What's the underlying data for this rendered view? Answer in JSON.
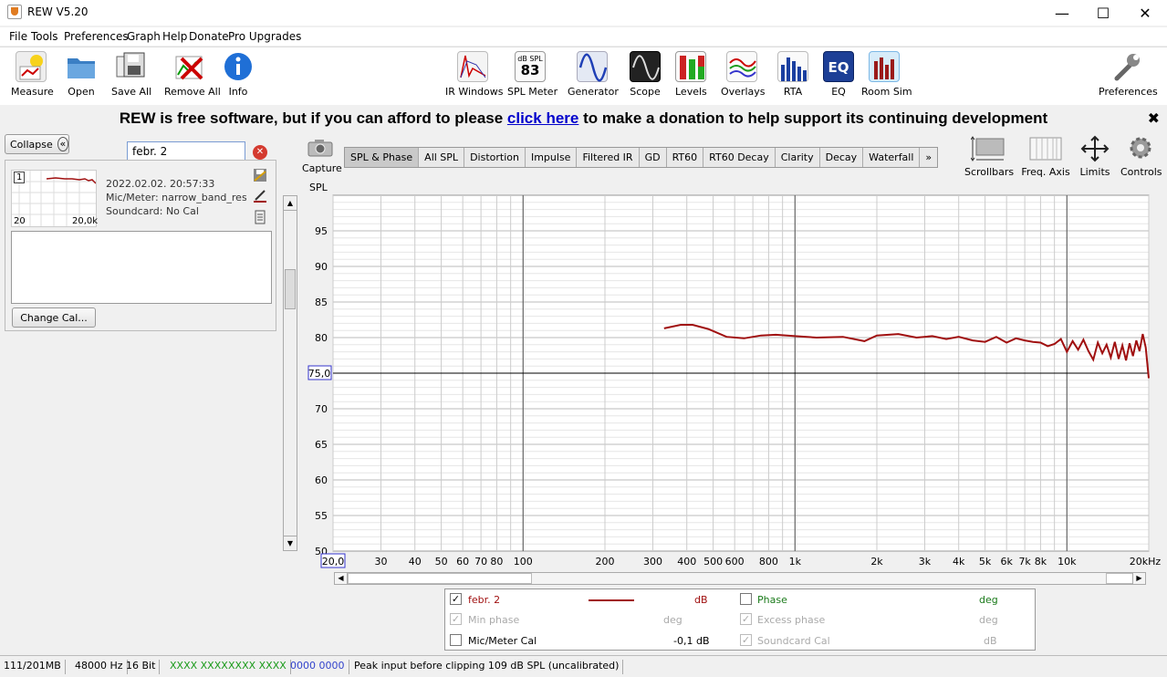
{
  "window": {
    "title": "REW V5.20",
    "minimize": "—",
    "maximize": "☐",
    "close": "✕"
  },
  "menu": [
    "File",
    "Tools",
    "Preferences",
    "Graph",
    "Help",
    "Donate",
    "Pro Upgrades"
  ],
  "toolbar_left": [
    "Measure",
    "Open",
    "Save All",
    "Remove All",
    "Info"
  ],
  "toolbar_center": [
    "IR Windows",
    "SPL Meter",
    "Generator",
    "Scope",
    "Levels",
    "Overlays",
    "RTA",
    "EQ",
    "Room Sim"
  ],
  "spl_meter_icon": {
    "unit": "dB SPL",
    "value": "83"
  },
  "eq_icon_text": "EQ",
  "toolbar_right": "Preferences",
  "banner": {
    "pre": "REW is free software, but if you can afford to please ",
    "link": "click here",
    "post": " to make a donation to help support its continuing development",
    "close": "✖"
  },
  "left": {
    "collapse": "Collapse",
    "collapse_icon": "«",
    "search_value": "febr. 2",
    "clear_icon": "✕",
    "measurement": {
      "index": "1",
      "thumb_min": "20",
      "thumb_max": "20,0k",
      "date": "2022.02.02. 20:57:33",
      "mic": "Mic/Meter: narrow_band_respo",
      "soundcard": "Soundcard: No Cal"
    },
    "change_cal": "Change Cal..."
  },
  "capture": "Capture",
  "tabs": [
    "SPL & Phase",
    "All SPL",
    "Distortion",
    "Impulse",
    "Filtered IR",
    "GD",
    "RT60",
    "RT60 Decay",
    "Clarity",
    "Decay",
    "Waterfall",
    "»"
  ],
  "right_tools": [
    "Scrollbars",
    "Freq. Axis",
    "Limits",
    "Controls"
  ],
  "scroll": {
    "up": "▲",
    "down": "▼",
    "left": "◀",
    "right": "▶"
  },
  "chart_data": {
    "type": "line",
    "ylabel": "SPL",
    "ylim": [
      50,
      100
    ],
    "yticks": [
      50,
      55,
      60,
      65,
      70,
      75,
      80,
      85,
      90,
      95
    ],
    "y_cursor_label": "75,0",
    "x_scale": "log",
    "xlim": [
      20,
      20000
    ],
    "xticks": [
      {
        "v": 20,
        "l": "20,0"
      },
      {
        "v": 30,
        "l": "30"
      },
      {
        "v": 40,
        "l": "40"
      },
      {
        "v": 50,
        "l": "50"
      },
      {
        "v": 60,
        "l": "60"
      },
      {
        "v": 70,
        "l": "70"
      },
      {
        "v": 80,
        "l": "80"
      },
      {
        "v": 100,
        "l": "100"
      },
      {
        "v": 200,
        "l": "200"
      },
      {
        "v": 300,
        "l": "300"
      },
      {
        "v": 400,
        "l": "400"
      },
      {
        "v": 500,
        "l": "500"
      },
      {
        "v": 600,
        "l": "600"
      },
      {
        "v": 800,
        "l": "800"
      },
      {
        "v": 1000,
        "l": "1k"
      },
      {
        "v": 2000,
        "l": "2k"
      },
      {
        "v": 3000,
        "l": "3k"
      },
      {
        "v": 4000,
        "l": "4k"
      },
      {
        "v": 5000,
        "l": "5k"
      },
      {
        "v": 6000,
        "l": "6k"
      },
      {
        "v": 7000,
        "l": "7k"
      },
      {
        "v": 8000,
        "l": "8k"
      },
      {
        "v": 10000,
        "l": "10k"
      },
      {
        "v": 20000,
        "l": "20kHz"
      }
    ],
    "grid": true,
    "reference_line": 75,
    "series": [
      {
        "name": "febr. 2",
        "color": "#a01010",
        "x": [
          330,
          380,
          420,
          480,
          560,
          650,
          750,
          850,
          1000,
          1200,
          1500,
          1800,
          2000,
          2400,
          2800,
          3200,
          3600,
          4000,
          4500,
          5000,
          5500,
          6000,
          6500,
          7000,
          7500,
          8000,
          8500,
          9000,
          9500,
          10000,
          10500,
          11000,
          11500,
          12000,
          12500,
          13000,
          13500,
          14000,
          14500,
          15000,
          15500,
          16000,
          16500,
          17000,
          17500,
          18000,
          18500,
          19000,
          19500,
          20000
        ],
        "y": [
          81.3,
          81.8,
          81.8,
          81.2,
          80.1,
          79.9,
          80.3,
          80.4,
          80.2,
          80.0,
          80.1,
          79.5,
          80.3,
          80.5,
          80.0,
          80.2,
          79.8,
          80.1,
          79.6,
          79.4,
          80.1,
          79.3,
          79.9,
          79.6,
          79.4,
          79.3,
          78.8,
          79.1,
          79.8,
          78.0,
          79.5,
          78.3,
          79.7,
          78.1,
          76.9,
          79.3,
          77.8,
          79.0,
          77.2,
          79.4,
          77.0,
          78.9,
          76.8,
          79.2,
          77.4,
          79.6,
          78.1,
          80.5,
          78.6,
          74.3
        ]
      }
    ]
  },
  "legend": {
    "r1": {
      "name": "febr. 2",
      "unit": "dB",
      "name2": "Phase",
      "unit2": "deg"
    },
    "r2": {
      "name": "Min phase",
      "unit": "deg",
      "name2": "Excess phase",
      "unit2": "deg"
    },
    "r3": {
      "name": "Mic/Meter Cal",
      "unit": "-0,1 dB",
      "name2": "Soundcard Cal",
      "unit2": "dB"
    },
    "check": "✓",
    "colors": {
      "meas": "#a01010",
      "phase": "#1a7a1a"
    }
  },
  "status": {
    "memory": "111/201MB",
    "rate": "48000 Hz",
    "bits": "16 Bit",
    "in_level": "XXXX XXXX",
    "out_level": "XXXX XXXX",
    "blue_level": "0000 0000",
    "message": "Peak input before clipping 109 dB SPL (uncalibrated)"
  }
}
